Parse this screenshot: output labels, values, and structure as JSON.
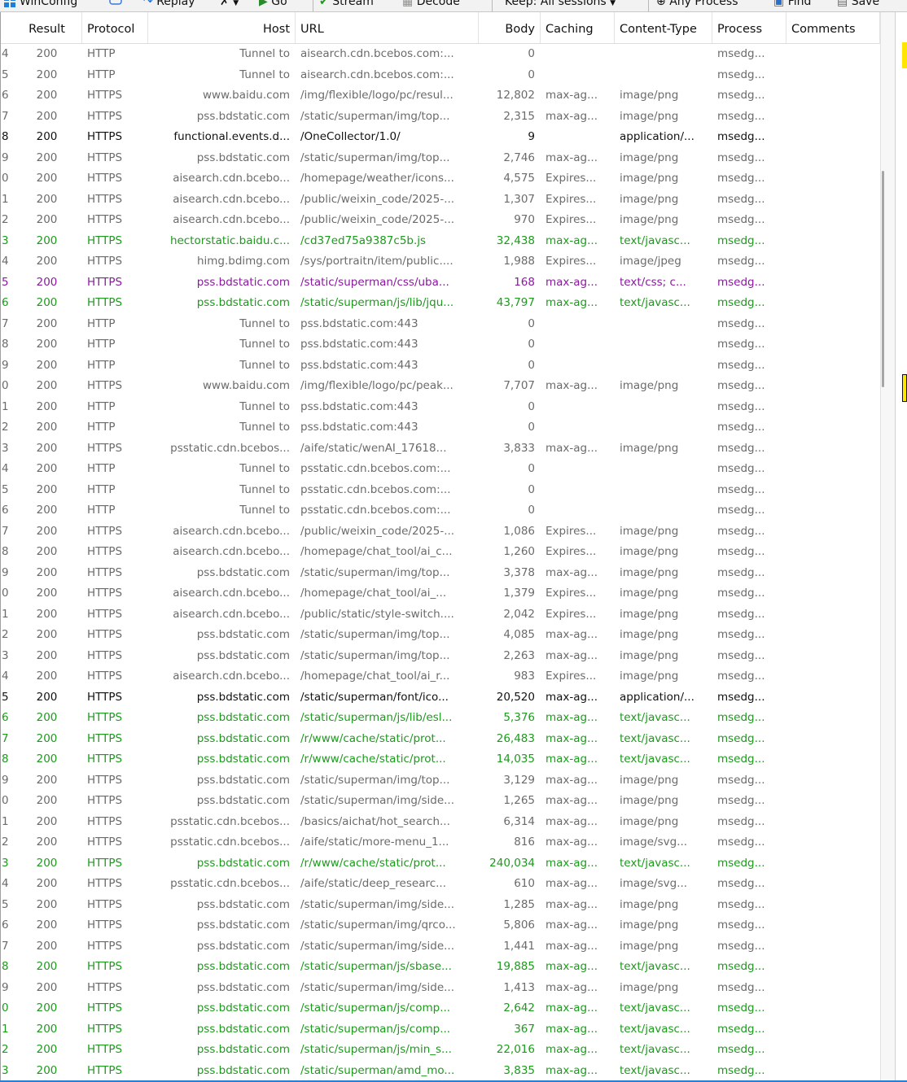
{
  "toolbar": {
    "winconfig": "WinConfig",
    "replay": "Replay",
    "go": "Go",
    "stream": "Stream",
    "decode": "Decode",
    "keep": "Keep: All sessions",
    "process": "Any Process",
    "find": "Find",
    "save": "Save"
  },
  "columns": {
    "result": "Result",
    "protocol": "Protocol",
    "host": "Host",
    "url": "URL",
    "body": "Body",
    "caching": "Caching",
    "content_type": "Content-Type",
    "process": "Process",
    "comments": "Comments"
  },
  "colors": {
    "gray": "#6b6b6b",
    "green": "#1d9a1d",
    "black": "#111111",
    "purple": "#8a1a9e"
  },
  "sessions": [
    {
      "n": "4",
      "result": "200",
      "protocol": "HTTP",
      "host": "Tunnel to",
      "url": "aisearch.cdn.bcebos.com:...",
      "body": "0",
      "caching": "",
      "content_type": "",
      "process": "msedg...",
      "style": "gray"
    },
    {
      "n": "5",
      "result": "200",
      "protocol": "HTTP",
      "host": "Tunnel to",
      "url": "aisearch.cdn.bcebos.com:...",
      "body": "0",
      "caching": "",
      "content_type": "",
      "process": "msedg...",
      "style": "gray"
    },
    {
      "n": "6",
      "result": "200",
      "protocol": "HTTPS",
      "host": "www.baidu.com",
      "url": "/img/flexible/logo/pc/resul...",
      "body": "12,802",
      "caching": "max-ag...",
      "content_type": "image/png",
      "process": "msedg...",
      "style": "gray"
    },
    {
      "n": "7",
      "result": "200",
      "protocol": "HTTPS",
      "host": "pss.bdstatic.com",
      "url": "/static/superman/img/top...",
      "body": "2,315",
      "caching": "max-ag...",
      "content_type": "image/png",
      "process": "msedg...",
      "style": "gray"
    },
    {
      "n": "8",
      "result": "200",
      "protocol": "HTTPS",
      "host": "functional.events.d...",
      "url": "/OneCollector/1.0/",
      "body": "9",
      "caching": "",
      "content_type": "application/...",
      "process": "msedg...",
      "style": "black"
    },
    {
      "n": "9",
      "result": "200",
      "protocol": "HTTPS",
      "host": "pss.bdstatic.com",
      "url": "/static/superman/img/top...",
      "body": "2,746",
      "caching": "max-ag...",
      "content_type": "image/png",
      "process": "msedg...",
      "style": "gray"
    },
    {
      "n": "0",
      "result": "200",
      "protocol": "HTTPS",
      "host": "aisearch.cdn.bcebo...",
      "url": "/homepage/weather/icons...",
      "body": "4,575",
      "caching": "Expires...",
      "content_type": "image/png",
      "process": "msedg...",
      "style": "gray"
    },
    {
      "n": "1",
      "result": "200",
      "protocol": "HTTPS",
      "host": "aisearch.cdn.bcebo...",
      "url": "/public/weixin_code/2025-...",
      "body": "1,307",
      "caching": "Expires...",
      "content_type": "image/png",
      "process": "msedg...",
      "style": "gray"
    },
    {
      "n": "2",
      "result": "200",
      "protocol": "HTTPS",
      "host": "aisearch.cdn.bcebo...",
      "url": "/public/weixin_code/2025-...",
      "body": "970",
      "caching": "Expires...",
      "content_type": "image/png",
      "process": "msedg...",
      "style": "gray"
    },
    {
      "n": "3",
      "result": "200",
      "protocol": "HTTPS",
      "host": "hectorstatic.baidu.c...",
      "url": "/cd37ed75a9387c5b.js",
      "body": "32,438",
      "caching": "max-ag...",
      "content_type": "text/javasc...",
      "process": "msedg...",
      "style": "green"
    },
    {
      "n": "4",
      "result": "200",
      "protocol": "HTTPS",
      "host": "himg.bdimg.com",
      "url": "/sys/portraitn/item/public....",
      "body": "1,988",
      "caching": "Expires...",
      "content_type": "image/jpeg",
      "process": "msedg...",
      "style": "gray"
    },
    {
      "n": "5",
      "result": "200",
      "protocol": "HTTPS",
      "host": "pss.bdstatic.com",
      "url": "/static/superman/css/uba...",
      "body": "168",
      "caching": "max-ag...",
      "content_type": "text/css; c...",
      "process": "msedg...",
      "style": "purple"
    },
    {
      "n": "6",
      "result": "200",
      "protocol": "HTTPS",
      "host": "pss.bdstatic.com",
      "url": "/static/superman/js/lib/jqu...",
      "body": "43,797",
      "caching": "max-ag...",
      "content_type": "text/javasc...",
      "process": "msedg...",
      "style": "green"
    },
    {
      "n": "7",
      "result": "200",
      "protocol": "HTTP",
      "host": "Tunnel to",
      "url": "pss.bdstatic.com:443",
      "body": "0",
      "caching": "",
      "content_type": "",
      "process": "msedg...",
      "style": "gray"
    },
    {
      "n": "8",
      "result": "200",
      "protocol": "HTTP",
      "host": "Tunnel to",
      "url": "pss.bdstatic.com:443",
      "body": "0",
      "caching": "",
      "content_type": "",
      "process": "msedg...",
      "style": "gray"
    },
    {
      "n": "9",
      "result": "200",
      "protocol": "HTTP",
      "host": "Tunnel to",
      "url": "pss.bdstatic.com:443",
      "body": "0",
      "caching": "",
      "content_type": "",
      "process": "msedg...",
      "style": "gray"
    },
    {
      "n": "0",
      "result": "200",
      "protocol": "HTTPS",
      "host": "www.baidu.com",
      "url": "/img/flexible/logo/pc/peak...",
      "body": "7,707",
      "caching": "max-ag...",
      "content_type": "image/png",
      "process": "msedg...",
      "style": "gray"
    },
    {
      "n": "1",
      "result": "200",
      "protocol": "HTTP",
      "host": "Tunnel to",
      "url": "pss.bdstatic.com:443",
      "body": "0",
      "caching": "",
      "content_type": "",
      "process": "msedg...",
      "style": "gray"
    },
    {
      "n": "2",
      "result": "200",
      "protocol": "HTTP",
      "host": "Tunnel to",
      "url": "pss.bdstatic.com:443",
      "body": "0",
      "caching": "",
      "content_type": "",
      "process": "msedg...",
      "style": "gray"
    },
    {
      "n": "3",
      "result": "200",
      "protocol": "HTTPS",
      "host": "psstatic.cdn.bcebos...",
      "url": "/aife/static/wenAI_17618...",
      "body": "3,833",
      "caching": "max-ag...",
      "content_type": "image/png",
      "process": "msedg...",
      "style": "gray"
    },
    {
      "n": "4",
      "result": "200",
      "protocol": "HTTP",
      "host": "Tunnel to",
      "url": "psstatic.cdn.bcebos.com:...",
      "body": "0",
      "caching": "",
      "content_type": "",
      "process": "msedg...",
      "style": "gray"
    },
    {
      "n": "5",
      "result": "200",
      "protocol": "HTTP",
      "host": "Tunnel to",
      "url": "psstatic.cdn.bcebos.com:...",
      "body": "0",
      "caching": "",
      "content_type": "",
      "process": "msedg...",
      "style": "gray"
    },
    {
      "n": "6",
      "result": "200",
      "protocol": "HTTP",
      "host": "Tunnel to",
      "url": "psstatic.cdn.bcebos.com:...",
      "body": "0",
      "caching": "",
      "content_type": "",
      "process": "msedg...",
      "style": "gray"
    },
    {
      "n": "7",
      "result": "200",
      "protocol": "HTTPS",
      "host": "aisearch.cdn.bcebo...",
      "url": "/public/weixin_code/2025-...",
      "body": "1,086",
      "caching": "Expires...",
      "content_type": "image/png",
      "process": "msedg...",
      "style": "gray"
    },
    {
      "n": "8",
      "result": "200",
      "protocol": "HTTPS",
      "host": "aisearch.cdn.bcebo...",
      "url": "/homepage/chat_tool/ai_c...",
      "body": "1,260",
      "caching": "Expires...",
      "content_type": "image/png",
      "process": "msedg...",
      "style": "gray"
    },
    {
      "n": "9",
      "result": "200",
      "protocol": "HTTPS",
      "host": "pss.bdstatic.com",
      "url": "/static/superman/img/top...",
      "body": "3,378",
      "caching": "max-ag...",
      "content_type": "image/png",
      "process": "msedg...",
      "style": "gray"
    },
    {
      "n": "0",
      "result": "200",
      "protocol": "HTTPS",
      "host": "aisearch.cdn.bcebo...",
      "url": "/homepage/chat_tool/ai_...",
      "body": "1,379",
      "caching": "Expires...",
      "content_type": "image/png",
      "process": "msedg...",
      "style": "gray"
    },
    {
      "n": "1",
      "result": "200",
      "protocol": "HTTPS",
      "host": "aisearch.cdn.bcebo...",
      "url": "/public/static/style-switch....",
      "body": "2,042",
      "caching": "Expires...",
      "content_type": "image/png",
      "process": "msedg...",
      "style": "gray"
    },
    {
      "n": "2",
      "result": "200",
      "protocol": "HTTPS",
      "host": "pss.bdstatic.com",
      "url": "/static/superman/img/top...",
      "body": "4,085",
      "caching": "max-ag...",
      "content_type": "image/png",
      "process": "msedg...",
      "style": "gray"
    },
    {
      "n": "3",
      "result": "200",
      "protocol": "HTTPS",
      "host": "pss.bdstatic.com",
      "url": "/static/superman/img/top...",
      "body": "2,263",
      "caching": "max-ag...",
      "content_type": "image/png",
      "process": "msedg...",
      "style": "gray"
    },
    {
      "n": "4",
      "result": "200",
      "protocol": "HTTPS",
      "host": "aisearch.cdn.bcebo...",
      "url": "/homepage/chat_tool/ai_r...",
      "body": "983",
      "caching": "Expires...",
      "content_type": "image/png",
      "process": "msedg...",
      "style": "gray"
    },
    {
      "n": "5",
      "result": "200",
      "protocol": "HTTPS",
      "host": "pss.bdstatic.com",
      "url": "/static/superman/font/ico...",
      "body": "20,520",
      "caching": "max-ag...",
      "content_type": "application/...",
      "process": "msedg...",
      "style": "black"
    },
    {
      "n": "6",
      "result": "200",
      "protocol": "HTTPS",
      "host": "pss.bdstatic.com",
      "url": "/static/superman/js/lib/esl...",
      "body": "5,376",
      "caching": "max-ag...",
      "content_type": "text/javasc...",
      "process": "msedg...",
      "style": "green"
    },
    {
      "n": "7",
      "result": "200",
      "protocol": "HTTPS",
      "host": "pss.bdstatic.com",
      "url": "/r/www/cache/static/prot...",
      "body": "26,483",
      "caching": "max-ag...",
      "content_type": "text/javasc...",
      "process": "msedg...",
      "style": "green"
    },
    {
      "n": "8",
      "result": "200",
      "protocol": "HTTPS",
      "host": "pss.bdstatic.com",
      "url": "/r/www/cache/static/prot...",
      "body": "14,035",
      "caching": "max-ag...",
      "content_type": "text/javasc...",
      "process": "msedg...",
      "style": "green"
    },
    {
      "n": "9",
      "result": "200",
      "protocol": "HTTPS",
      "host": "pss.bdstatic.com",
      "url": "/static/superman/img/top...",
      "body": "3,129",
      "caching": "max-ag...",
      "content_type": "image/png",
      "process": "msedg...",
      "style": "gray"
    },
    {
      "n": "0",
      "result": "200",
      "protocol": "HTTPS",
      "host": "pss.bdstatic.com",
      "url": "/static/superman/img/side...",
      "body": "1,265",
      "caching": "max-ag...",
      "content_type": "image/png",
      "process": "msedg...",
      "style": "gray"
    },
    {
      "n": "1",
      "result": "200",
      "protocol": "HTTPS",
      "host": "psstatic.cdn.bcebos...",
      "url": "/basics/aichat/hot_search...",
      "body": "6,314",
      "caching": "max-ag...",
      "content_type": "image/png",
      "process": "msedg...",
      "style": "gray"
    },
    {
      "n": "2",
      "result": "200",
      "protocol": "HTTPS",
      "host": "psstatic.cdn.bcebos...",
      "url": "/aife/static/more-menu_1...",
      "body": "816",
      "caching": "max-ag...",
      "content_type": "image/svg...",
      "process": "msedg...",
      "style": "gray"
    },
    {
      "n": "3",
      "result": "200",
      "protocol": "HTTPS",
      "host": "pss.bdstatic.com",
      "url": "/r/www/cache/static/prot...",
      "body": "240,034",
      "caching": "max-ag...",
      "content_type": "text/javasc...",
      "process": "msedg...",
      "style": "green"
    },
    {
      "n": "4",
      "result": "200",
      "protocol": "HTTPS",
      "host": "psstatic.cdn.bcebos...",
      "url": "/aife/static/deep_researc...",
      "body": "610",
      "caching": "max-ag...",
      "content_type": "image/svg...",
      "process": "msedg...",
      "style": "gray"
    },
    {
      "n": "5",
      "result": "200",
      "protocol": "HTTPS",
      "host": "pss.bdstatic.com",
      "url": "/static/superman/img/side...",
      "body": "1,285",
      "caching": "max-ag...",
      "content_type": "image/png",
      "process": "msedg...",
      "style": "gray"
    },
    {
      "n": "6",
      "result": "200",
      "protocol": "HTTPS",
      "host": "pss.bdstatic.com",
      "url": "/static/superman/img/qrco...",
      "body": "5,806",
      "caching": "max-ag...",
      "content_type": "image/png",
      "process": "msedg...",
      "style": "gray"
    },
    {
      "n": "7",
      "result": "200",
      "protocol": "HTTPS",
      "host": "pss.bdstatic.com",
      "url": "/static/superman/img/side...",
      "body": "1,441",
      "caching": "max-ag...",
      "content_type": "image/png",
      "process": "msedg...",
      "style": "gray"
    },
    {
      "n": "8",
      "result": "200",
      "protocol": "HTTPS",
      "host": "pss.bdstatic.com",
      "url": "/static/superman/js/sbase...",
      "body": "19,885",
      "caching": "max-ag...",
      "content_type": "text/javasc...",
      "process": "msedg...",
      "style": "green"
    },
    {
      "n": "9",
      "result": "200",
      "protocol": "HTTPS",
      "host": "pss.bdstatic.com",
      "url": "/static/superman/img/side...",
      "body": "1,413",
      "caching": "max-ag...",
      "content_type": "image/png",
      "process": "msedg...",
      "style": "gray"
    },
    {
      "n": "0",
      "result": "200",
      "protocol": "HTTPS",
      "host": "pss.bdstatic.com",
      "url": "/static/superman/js/comp...",
      "body": "2,642",
      "caching": "max-ag...",
      "content_type": "text/javasc...",
      "process": "msedg...",
      "style": "green"
    },
    {
      "n": "1",
      "result": "200",
      "protocol": "HTTPS",
      "host": "pss.bdstatic.com",
      "url": "/static/superman/js/comp...",
      "body": "367",
      "caching": "max-ag...",
      "content_type": "text/javasc...",
      "process": "msedg...",
      "style": "green"
    },
    {
      "n": "2",
      "result": "200",
      "protocol": "HTTPS",
      "host": "pss.bdstatic.com",
      "url": "/static/superman/js/min_s...",
      "body": "22,016",
      "caching": "max-ag...",
      "content_type": "text/javasc...",
      "process": "msedg...",
      "style": "green"
    },
    {
      "n": "3",
      "result": "200",
      "protocol": "HTTPS",
      "host": "pss.bdstatic.com",
      "url": "/static/superman/amd_mo...",
      "body": "3,835",
      "caching": "max-ag...",
      "content_type": "text/javasc...",
      "process": "msedg...",
      "style": "green"
    }
  ]
}
